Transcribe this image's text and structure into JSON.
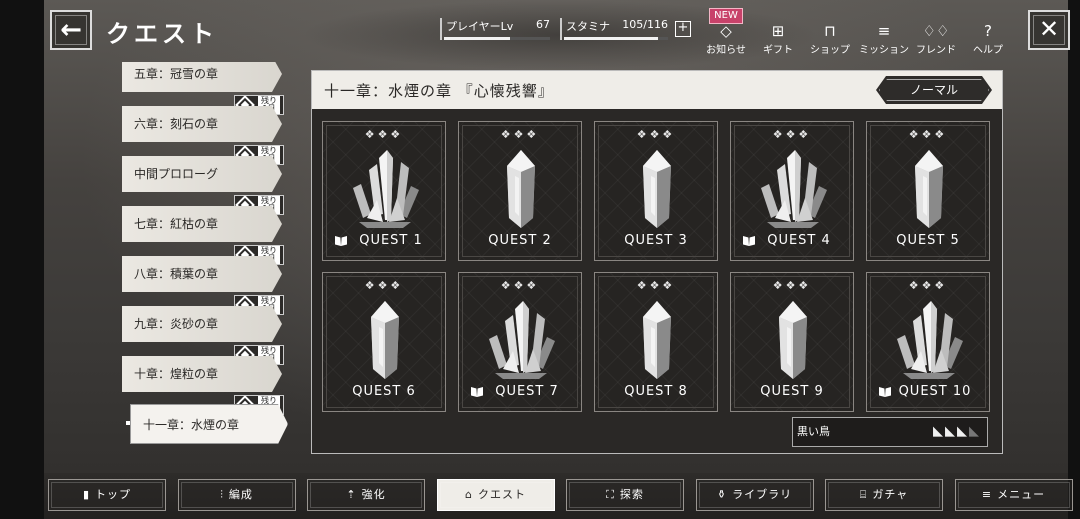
{
  "header": {
    "title": "クエスト",
    "player_level": {
      "label": "プレイヤーLv",
      "value": "67",
      "fill": 0.62
    },
    "stamina": {
      "label": "スタミナ",
      "value": "105/116",
      "fill": 0.905
    },
    "plus": "+",
    "new_badge": "NEW",
    "icons": [
      {
        "label": "お知らせ",
        "glyph": "◇"
      },
      {
        "label": "ギフト",
        "glyph": "⊞"
      },
      {
        "label": "ショップ",
        "glyph": "⊓"
      },
      {
        "label": "ミッション",
        "glyph": "≡"
      },
      {
        "label": "フレンド",
        "glyph": "♢♢"
      },
      {
        "label": "ヘルプ",
        "glyph": "?"
      }
    ]
  },
  "chapters": [
    {
      "label": "五章：冠雪の章",
      "badge": "残り 1日"
    },
    {
      "label": "六章：刻石の章",
      "badge": "残り 1日"
    },
    {
      "label": "中間プロローグ",
      "badge": "残り 1日"
    },
    {
      "label": "七章：紅枯の章",
      "badge": "残り 1日"
    },
    {
      "label": "八章：積葉の章",
      "badge": "残り 1日"
    },
    {
      "label": "九章：炎砂の章",
      "badge": "残り 1日"
    },
    {
      "label": "十章：煌粒の章",
      "badge": "残り 1日"
    },
    {
      "label": "十一章：水煙の章",
      "badge": "残り 1日"
    }
  ],
  "panel": {
    "title": "十一章：水煙の章 『心懐残響』",
    "difficulty": "ノーマル",
    "clovers": "❖❖❖",
    "quests": [
      {
        "label": "QUEST 1",
        "type": "cluster",
        "book": true
      },
      {
        "label": "QUEST 2",
        "type": "single",
        "book": false
      },
      {
        "label": "QUEST 3",
        "type": "single",
        "book": false
      },
      {
        "label": "QUEST 4",
        "type": "cluster",
        "book": true
      },
      {
        "label": "QUEST 5",
        "type": "single",
        "book": false
      },
      {
        "label": "QUEST 6",
        "type": "single",
        "book": false
      },
      {
        "label": "QUEST 7",
        "type": "cluster",
        "book": true
      },
      {
        "label": "QUEST 8",
        "type": "single",
        "book": false
      },
      {
        "label": "QUEST 9",
        "type": "single",
        "book": false
      },
      {
        "label": "QUEST 10",
        "type": "cluster",
        "book": true
      }
    ],
    "bird_label": "黒い鳥",
    "birds_collected": 3,
    "birds_total": 4
  },
  "nav": [
    {
      "label": "トップ",
      "icon": "▮"
    },
    {
      "label": "編成",
      "icon": "⫶"
    },
    {
      "label": "強化",
      "icon": "⇡"
    },
    {
      "label": "クエスト",
      "icon": "⌂"
    },
    {
      "label": "探索",
      "icon": "⛶"
    },
    {
      "label": "ライブラリ",
      "icon": "⚱"
    },
    {
      "label": "ガチャ",
      "icon": "⌸"
    },
    {
      "label": "メニュー",
      "icon": "≡"
    }
  ]
}
